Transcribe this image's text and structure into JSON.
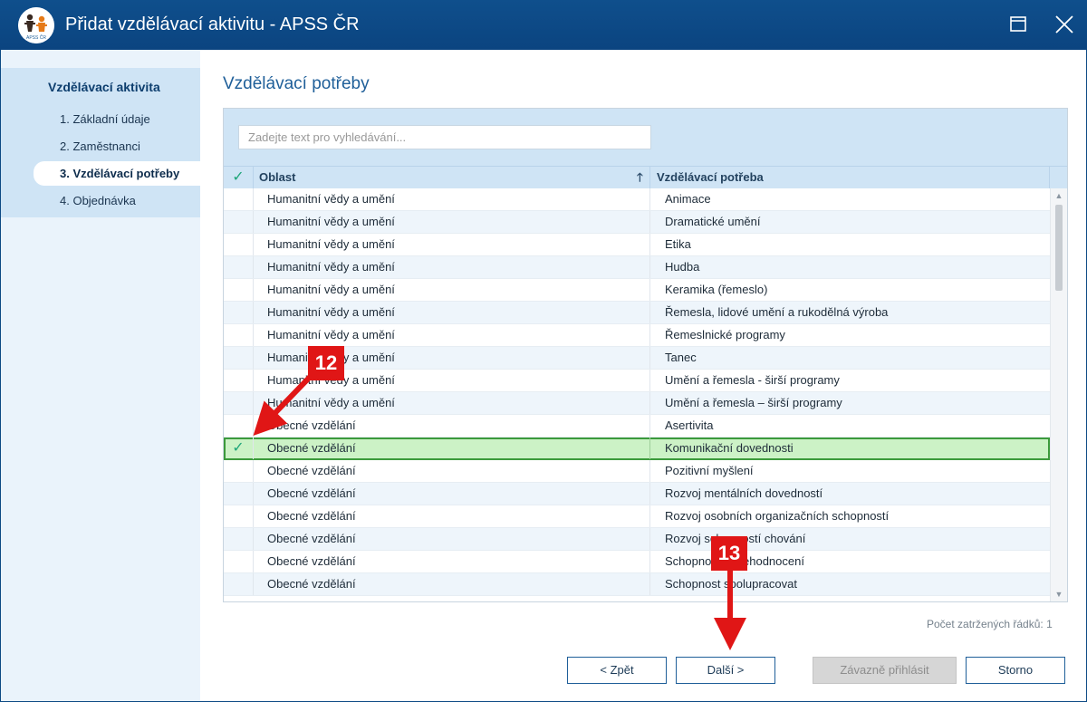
{
  "window": {
    "title": "Přidat vzdělávací aktivitu - APSS ČR",
    "logo_text": "APSS ČR",
    "controls": {
      "maximize_icon": "maximize-icon",
      "close_icon": "close-icon"
    }
  },
  "sidebar": {
    "title": "Vzdělávací aktivita",
    "items": [
      {
        "label": "1. Základní údaje",
        "active": false
      },
      {
        "label": "2. Zaměstnanci",
        "active": false
      },
      {
        "label": "3. Vzdělávací potřeby",
        "active": true
      },
      {
        "label": "4. Objednávka",
        "active": false
      }
    ]
  },
  "main": {
    "title": "Vzdělávací potřeby",
    "search": {
      "placeholder": "Zadejte text pro vyhledávání...",
      "value": ""
    },
    "columns": {
      "area": "Oblast",
      "need": "Vzdělávací potřeba"
    },
    "rows": [
      {
        "area": "Humanitní vědy a umění",
        "need": "Animace",
        "checked": false
      },
      {
        "area": "Humanitní vědy a umění",
        "need": "Dramatické umění",
        "checked": false
      },
      {
        "area": "Humanitní vědy a umění",
        "need": "Etika",
        "checked": false
      },
      {
        "area": "Humanitní vědy a umění",
        "need": "Hudba",
        "checked": false
      },
      {
        "area": "Humanitní vědy a umění",
        "need": "Keramika (řemeslo)",
        "checked": false
      },
      {
        "area": "Humanitní vědy a umění",
        "need": "Řemesla, lidové umění a rukodělná výroba",
        "checked": false
      },
      {
        "area": "Humanitní vědy a umění",
        "need": "Řemeslnické programy",
        "checked": false
      },
      {
        "area": "Humanitní vědy a umění",
        "need": "Tanec",
        "checked": false
      },
      {
        "area": "Humanitní vědy a umění",
        "need": "Umění a řemesla - širší programy",
        "checked": false
      },
      {
        "area": "Humanitní vědy a umění",
        "need": "Umění a řemesla – širší programy",
        "checked": false
      },
      {
        "area": "Obecné vzdělání",
        "need": "Asertivita",
        "checked": false
      },
      {
        "area": "Obecné vzdělání",
        "need": "Komunikační dovednosti",
        "checked": true
      },
      {
        "area": "Obecné vzdělání",
        "need": "Pozitivní myšlení",
        "checked": false
      },
      {
        "area": "Obecné vzdělání",
        "need": "Rozvoj mentálních dovedností",
        "checked": false
      },
      {
        "area": "Obecné vzdělání",
        "need": "Rozvoj osobních organizačních schopností",
        "checked": false
      },
      {
        "area": "Obecné vzdělání",
        "need": "Rozvoj schopností chování",
        "checked": false
      },
      {
        "area": "Obecné vzdělání",
        "need": "Schopnost sebehodnocení",
        "checked": false
      },
      {
        "area": "Obecné vzdělání",
        "need": "Schopnost spolupracovat",
        "checked": false
      }
    ],
    "row_count_label": "Počet zatržených řádků: 1"
  },
  "buttons": {
    "back": "< Zpět",
    "next": "Další >",
    "register": "Závazně přihlásit",
    "cancel": "Storno"
  },
  "annotations": [
    {
      "label": "12"
    },
    {
      "label": "13"
    }
  ],
  "colors": {
    "titlebar": "#0b4480",
    "accent": "#1f5f99",
    "selected_row": "#ccf2c6",
    "check": "#1fa67a",
    "callout": "#e01616"
  }
}
